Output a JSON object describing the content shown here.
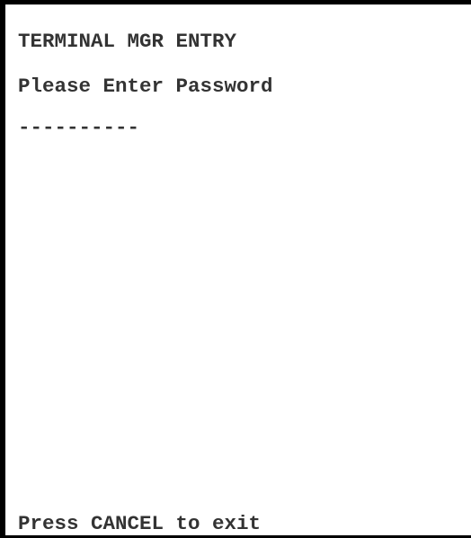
{
  "terminal": {
    "title": "TERMINAL MGR ENTRY",
    "prompt": "Please Enter Password",
    "password_mask": "----------",
    "footer": "Press CANCEL to exit"
  }
}
